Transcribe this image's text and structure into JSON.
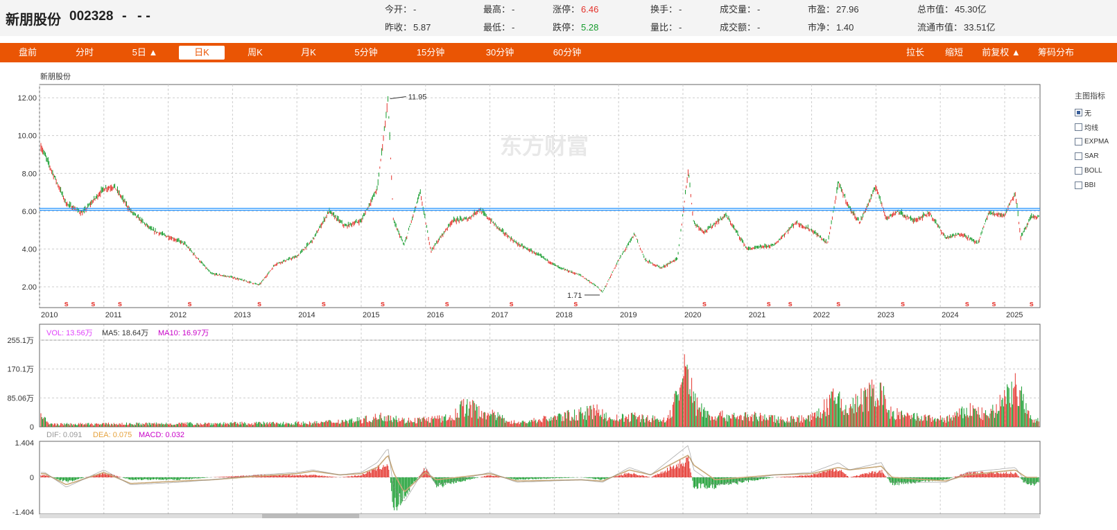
{
  "stock": {
    "name": "新朋股份",
    "code": "002328",
    "price": "-",
    "change": "- -"
  },
  "quote": [
    {
      "label": "今开：",
      "value": "-",
      "color": ""
    },
    {
      "label": "最高：",
      "value": "-",
      "color": ""
    },
    {
      "label": "涨停：",
      "value": "6.46",
      "color": "red"
    },
    {
      "label": "换手：",
      "value": "-",
      "color": ""
    },
    {
      "label": "成交量：",
      "value": "-",
      "color": ""
    },
    {
      "label": "市盈：",
      "value": "27.96",
      "color": ""
    },
    {
      "label": "总市值：",
      "value": "45.30亿",
      "color": ""
    },
    {
      "label": "昨收：",
      "value": "5.87",
      "color": ""
    },
    {
      "label": "最低：",
      "value": "-",
      "color": ""
    },
    {
      "label": "跌停：",
      "value": "5.28",
      "color": "green"
    },
    {
      "label": "量比：",
      "value": "-",
      "color": ""
    },
    {
      "label": "成交额：",
      "value": "-",
      "color": ""
    },
    {
      "label": "市净：",
      "value": "1.40",
      "color": ""
    },
    {
      "label": "流通市值：",
      "value": "33.51亿",
      "color": ""
    }
  ],
  "tabs": [
    "盘前",
    "分时",
    "5日 ▲",
    "日K",
    "周K",
    "月K",
    "5分钟",
    "15分钟",
    "30分钟",
    "60分钟"
  ],
  "active_tab": "日K",
  "right_tabs": [
    "拉长",
    "缩短",
    "前复权 ▲",
    "筹码分布"
  ],
  "indicator_panel": {
    "title": "主图指标",
    "options": [
      "无",
      "均线",
      "EXPMA",
      "SAR",
      "BOLL",
      "BBI"
    ],
    "selected": "无"
  },
  "colors": {
    "accent": "#ea5504",
    "up": "#e4312a",
    "down": "#139b2b",
    "support_line": "#1e90ff",
    "dea": "#c8a878",
    "vol_label": "#e040fb",
    "ma10": "#c800c8"
  },
  "chart_data": [
    {
      "type": "candlestick",
      "title": "新朋股份",
      "watermark": "东方财富",
      "x_ticks": [
        "2010",
        "2011",
        "2012",
        "2013",
        "2014",
        "2015",
        "2016",
        "2017",
        "2018",
        "2019",
        "2020",
        "2021",
        "2022",
        "2023",
        "2024",
        "2025"
      ],
      "y_ticks": [
        "2.00",
        "4.00",
        "6.00",
        "8.00",
        "10.00",
        "12.00"
      ],
      "ylim": [
        0.9,
        12.7
      ],
      "x": [
        "2010-01",
        "2010-06",
        "2010-09",
        "2011-01",
        "2011-03",
        "2011-06",
        "2011-10",
        "2012-04",
        "2012-09",
        "2013-01",
        "2013-06",
        "2013-09",
        "2014-01",
        "2014-04",
        "2014-07",
        "2014-10",
        "2015-01",
        "2015-04",
        "2015-06",
        "2015-07",
        "2015-09",
        "2015-12",
        "2016-02",
        "2016-06",
        "2016-09",
        "2016-11",
        "2017-03",
        "2017-06",
        "2017-10",
        "2018-02",
        "2018-06",
        "2018-09",
        "2018-10",
        "2019-01",
        "2019-04",
        "2019-06",
        "2019-09",
        "2019-12",
        "2020-02",
        "2020-03",
        "2020-05",
        "2020-09",
        "2021-01",
        "2021-06",
        "2021-10",
        "2022-01",
        "2022-04",
        "2022-06",
        "2022-08",
        "2022-10",
        "2023-01",
        "2023-03",
        "2023-05",
        "2023-08",
        "2023-11",
        "2024-02",
        "2024-05",
        "2024-08",
        "2024-10",
        "2025-01",
        "2025-03",
        "2025-04",
        "2025-06"
      ],
      "close": [
        9.6,
        6.4,
        5.9,
        7.2,
        7.3,
        6.0,
        5.0,
        4.3,
        2.7,
        2.5,
        2.1,
        3.2,
        3.6,
        4.5,
        6.0,
        5.2,
        5.5,
        7.2,
        11.95,
        5.5,
        4.2,
        7.0,
        3.9,
        5.5,
        5.6,
        6.1,
        5.0,
        4.3,
        3.7,
        3.0,
        2.6,
        2.0,
        1.71,
        3.4,
        4.8,
        3.4,
        3.0,
        3.5,
        8.2,
        5.4,
        4.9,
        5.8,
        4.0,
        4.2,
        5.4,
        5.0,
        4.3,
        7.5,
        6.2,
        5.4,
        7.3,
        5.6,
        6.0,
        5.5,
        5.9,
        4.6,
        4.8,
        4.3,
        5.9,
        5.8,
        7.0,
        4.6,
        5.7
      ],
      "annotations": [
        {
          "text": "11.95",
          "x": "2015-06",
          "y": 11.95
        },
        {
          "text": "1.71",
          "x": "2018-10",
          "y": 1.71
        }
      ],
      "support_lines": [
        6.05,
        6.15
      ],
      "dividend_markers": [
        "2010-06",
        "2010-11",
        "2011-04",
        "2012-05",
        "2013-06",
        "2014-06",
        "2015-05",
        "2016-05",
        "2017-05",
        "2018-05",
        "2020-05",
        "2021-05",
        "2021-09",
        "2022-06",
        "2023-06",
        "2024-06",
        "2024-11",
        "2025-06"
      ],
      "mark_labels": [
        "s",
        "s",
        "s",
        "s",
        "s",
        "s",
        "s",
        "s",
        "s",
        "s",
        "s",
        "s",
        "s",
        "s",
        "s",
        "s",
        "s",
        "s"
      ]
    },
    {
      "type": "bar",
      "legend": [
        "VOL: 13.56万",
        "MA5: 18.64万",
        "MA10: 16.97万"
      ],
      "y_ticks": [
        "0",
        "85.06万",
        "170.1万",
        "255.1万"
      ],
      "ylim": [
        0,
        255.1
      ],
      "x": [
        "2010-01",
        "2010-03",
        "2014-04",
        "2015-02",
        "2015-06",
        "2015-09",
        "2016-06",
        "2016-08",
        "2017-06",
        "2018-10",
        "2018-11",
        "2019-04",
        "2019-10",
        "2020-02",
        "2020-03",
        "2020-06",
        "2021-03",
        "2021-07",
        "2022-01",
        "2022-06",
        "2022-07",
        "2023-02",
        "2023-03",
        "2023-07",
        "2024-02",
        "2024-07",
        "2024-10",
        "2025-03",
        "2025-06"
      ],
      "values": [
        45,
        10,
        15,
        30,
        45,
        25,
        35,
        85,
        15,
        65,
        30,
        40,
        25,
        240,
        100,
        45,
        40,
        30,
        35,
        120,
        65,
        155,
        60,
        40,
        30,
        70,
        40,
        165,
        25
      ]
    },
    {
      "type": "bar",
      "legend": [
        "DIF: 0.091",
        "DEA: 0.075",
        "MACD: 0.032"
      ],
      "y_ticks": [
        "1.404",
        "0",
        "-1.404"
      ],
      "ylim": [
        -1.404,
        1.404
      ],
      "x": [
        "2010-02",
        "2010-06",
        "2011-01",
        "2011-06",
        "2012-03",
        "2012-09",
        "2013-06",
        "2014-01",
        "2014-04",
        "2014-09",
        "2015-01",
        "2015-04",
        "2015-06",
        "2015-07",
        "2015-09",
        "2016-01",
        "2016-03",
        "2017-01",
        "2017-06",
        "2018-06",
        "2018-10",
        "2019-03",
        "2019-07",
        "2020-02",
        "2020-03",
        "2020-07",
        "2021-06",
        "2022-01",
        "2022-06",
        "2022-08",
        "2023-02",
        "2023-04",
        "2024-02",
        "2024-06",
        "2025-03",
        "2025-05"
      ],
      "dif": [
        0.2,
        -0.4,
        0.3,
        -0.3,
        -0.2,
        -0.1,
        0.1,
        0.2,
        0.3,
        0.1,
        0.2,
        0.6,
        1.2,
        -0.4,
        -1.0,
        0.4,
        -0.3,
        0.2,
        -0.2,
        -0.1,
        -0.2,
        0.4,
        0.1,
        1.3,
        0.3,
        -0.3,
        0.1,
        0.2,
        0.6,
        0.3,
        0.6,
        -0.2,
        -0.2,
        0.2,
        0.4,
        -0.2
      ],
      "dea": [
        0.15,
        -0.3,
        0.2,
        -0.25,
        -0.15,
        -0.1,
        0.05,
        0.15,
        0.25,
        0.1,
        0.15,
        0.4,
        0.9,
        0.2,
        -0.6,
        0.2,
        -0.1,
        0.15,
        -0.15,
        -0.1,
        -0.15,
        0.3,
        0.1,
        0.9,
        0.5,
        -0.1,
        0.1,
        0.15,
        0.4,
        0.3,
        0.45,
        0.0,
        -0.15,
        0.1,
        0.3,
        0.0
      ],
      "macd": [
        0.1,
        -0.2,
        0.2,
        -0.1,
        -0.1,
        0.0,
        0.1,
        0.1,
        0.1,
        0.0,
        0.1,
        0.4,
        0.6,
        -1.3,
        -0.8,
        0.4,
        -0.4,
        0.1,
        -0.1,
        0.0,
        -0.1,
        0.2,
        0.0,
        0.8,
        -0.4,
        -0.4,
        0.0,
        0.1,
        0.4,
        0.0,
        0.3,
        -0.3,
        -0.1,
        0.2,
        0.2,
        -0.3
      ]
    }
  ]
}
